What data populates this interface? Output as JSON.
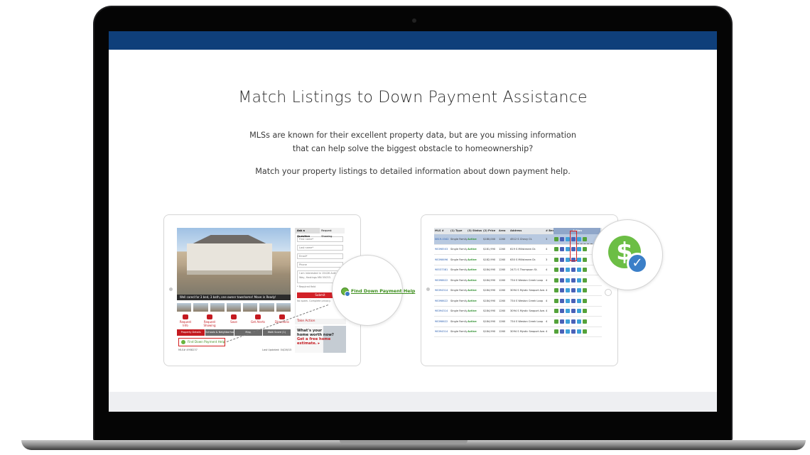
{
  "hero": {
    "headline": "Match Listings to Down Payment Assistance",
    "paragraph1": "MLSs are known for their excellent property data, but are you missing information that can help solve the biggest obstacle to homeownership?",
    "paragraph2": "Match your property listings to detailed information about down payment help."
  },
  "listing_card": {
    "photo_caption": "Well cared for 3 bed, 3 bath, one owner townhome! Move in Ready!",
    "quick_actions": [
      "Request Info",
      "Request Showing",
      "Save",
      "Get Alerts",
      "Directions"
    ],
    "tabs": [
      "Property Details",
      "Schools & Neighborhood",
      "Map",
      "Walk Score (1)"
    ],
    "find_dph_label": "Find Down Payment Help",
    "mls_number": "MLS# 4958237",
    "last_updated": "Last Updated: 04/26/15",
    "form_tabs": [
      "Ask a Question",
      "Request Showing"
    ],
    "form_fields": [
      "First name*",
      "Last name*",
      "Email*",
      "Phone"
    ],
    "form_message": "I am interested in 15426 Anthem Way, Hastings MN 55033.",
    "required_note": "* Required field",
    "submit_label": "Submit",
    "privacy_note": "No spam. Complete privacy.",
    "take_action_label": "Take Action",
    "ad_line1": "What's your",
    "ad_line2": "home worth now?",
    "ad_line3": "Get a free home",
    "ad_line4": "estimate. ▸",
    "zoom_link_label": "Find Down Payment Help"
  },
  "table_card": {
    "headers": [
      "MLS #",
      "(1) Type",
      "(3) Status",
      "(2) Price",
      "Area",
      "Address",
      "# Beds",
      "Action"
    ],
    "rows": [
      {
        "mls": "0819-0342",
        "type": "Single Family",
        "status": "Active",
        "price": "$180,000",
        "area": "1260",
        "address": "4512 S Chevy Ct.",
        "beds": "3"
      },
      {
        "mls": "98398503",
        "type": "Single Family",
        "status": "Active",
        "price": "$181,990",
        "area": "1260",
        "address": "619 S Millstream Dr.",
        "beds": "4"
      },
      {
        "mls": "98398696",
        "type": "Single Family",
        "status": "Active",
        "price": "$182,990",
        "area": "1260",
        "address": "630 S Millstream Dr.",
        "beds": "3"
      },
      {
        "mls": "98537381",
        "type": "Single Family",
        "status": "Active",
        "price": "$184,990",
        "area": "1260",
        "address": "2471 S Thompson St.",
        "beds": "4"
      },
      {
        "mls": "98398622",
        "type": "Single Family",
        "status": "Active",
        "price": "$184,990",
        "area": "1260",
        "address": "734 S Weston Creek Loop",
        "beds": "4"
      },
      {
        "mls": "98394314",
        "type": "Single Family",
        "status": "Active",
        "price": "$184,990",
        "area": "1260",
        "address": "3094 S Mystic Seaport Ave.",
        "beds": "4"
      },
      {
        "mls": "98398622",
        "type": "Single Family",
        "status": "Active",
        "price": "$184,990",
        "area": "1260",
        "address": "734 S Weston Creek Loop",
        "beds": "4"
      },
      {
        "mls": "98394314",
        "type": "Single Family",
        "status": "Active",
        "price": "$184,990",
        "area": "1260",
        "address": "3094 S Mystic Seaport Ave.",
        "beds": "4"
      },
      {
        "mls": "98398622",
        "type": "Single Family",
        "status": "Active",
        "price": "$184,990",
        "area": "1260",
        "address": "734 S Weston Creek Loop",
        "beds": "4"
      },
      {
        "mls": "98394314",
        "type": "Single Family",
        "status": "Active",
        "price": "$184,990",
        "area": "1260",
        "address": "3094 S Mystic Seaport Ave.",
        "beds": "4"
      }
    ],
    "zoom_icon": "dollar-check-icon"
  },
  "colors": {
    "header_bar": "#0f3f7a",
    "accent_red": "#c41a20",
    "accent_green": "#6cbe45",
    "accent_blue": "#3b7fc8"
  }
}
